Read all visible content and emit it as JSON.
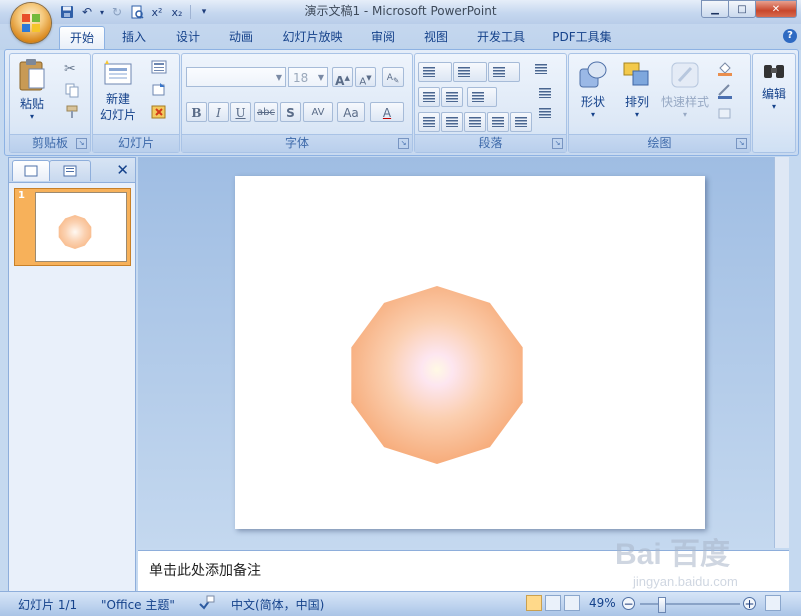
{
  "window": {
    "title": "演示文稿1 - Microsoft PowerPoint"
  },
  "qat": {
    "icons": [
      "save-icon",
      "undo-icon",
      "redo-icon",
      "print-preview-icon",
      "customize-icon"
    ]
  },
  "tabs": [
    {
      "label": "开始",
      "active": true
    },
    {
      "label": "插入"
    },
    {
      "label": "设计"
    },
    {
      "label": "动画"
    },
    {
      "label": "幻灯片放映"
    },
    {
      "label": "审阅"
    },
    {
      "label": "视图"
    },
    {
      "label": "开发工具"
    },
    {
      "label": "PDF工具集"
    }
  ],
  "ribbon": {
    "clipboard": {
      "label": "剪贴板",
      "paste": "粘贴"
    },
    "slides": {
      "label": "幻灯片",
      "new_slide": "新建\n幻灯片"
    },
    "font": {
      "label": "字体",
      "font_size": "18",
      "bold": "B",
      "italic": "I",
      "underline": "U",
      "strike": "abc",
      "shadow": "S",
      "spacing": "AV",
      "case": "Aa",
      "color": "A"
    },
    "paragraph": {
      "label": "段落"
    },
    "drawing": {
      "label": "绘图",
      "shapes": "形状",
      "arrange": "排列",
      "quick_styles": "快速样式"
    },
    "editing": {
      "label": "编辑"
    }
  },
  "slide_panel": {
    "thumbnail_number": "1"
  },
  "notes": {
    "placeholder": "单击此处添加备注"
  },
  "status": {
    "slide_info": "幻灯片 1/1",
    "theme": "\"Office 主题\"",
    "language": "中文(简体，中国)",
    "zoom_percent": "49%",
    "zoom_level": 0.49
  },
  "watermark": {
    "text": "Bai 百度",
    "sub": "jingyan.baidu.com"
  },
  "colors": {
    "accent": "#f7b15a",
    "ribbon": "#dde8f6",
    "shape_center": "#fff9e4",
    "shape_edge": "#f4a06a"
  }
}
